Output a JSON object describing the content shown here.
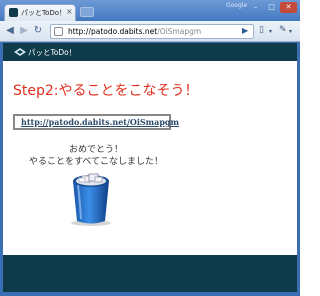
{
  "browser": {
    "tab_title": "パッとToDo！",
    "tab_close": "×",
    "brand": "Google",
    "window_min": "–",
    "window_max": "□",
    "window_close": "✕",
    "url_host": "http://patodo.dabits.net",
    "url_path": "/OiSmapgm",
    "back": "◀",
    "forward": "▶",
    "reload": "↻",
    "go": "▶",
    "page_menu": "▯",
    "tools_menu": "✎",
    "caret": "▾"
  },
  "header": {
    "site_title": "パッとToDo！"
  },
  "main": {
    "step_title": "Step2:やることをこなそう！",
    "link_text": "http://patodo.dabits.net/OiSmapgm",
    "congrats_line1": "おめでとう！",
    "congrats_line2": "やることをすべてこなしました！"
  },
  "colors": {
    "header_bg": "#0f3a4a",
    "step_title": "#e0301e",
    "trash_blue": "#1f6fc8"
  }
}
